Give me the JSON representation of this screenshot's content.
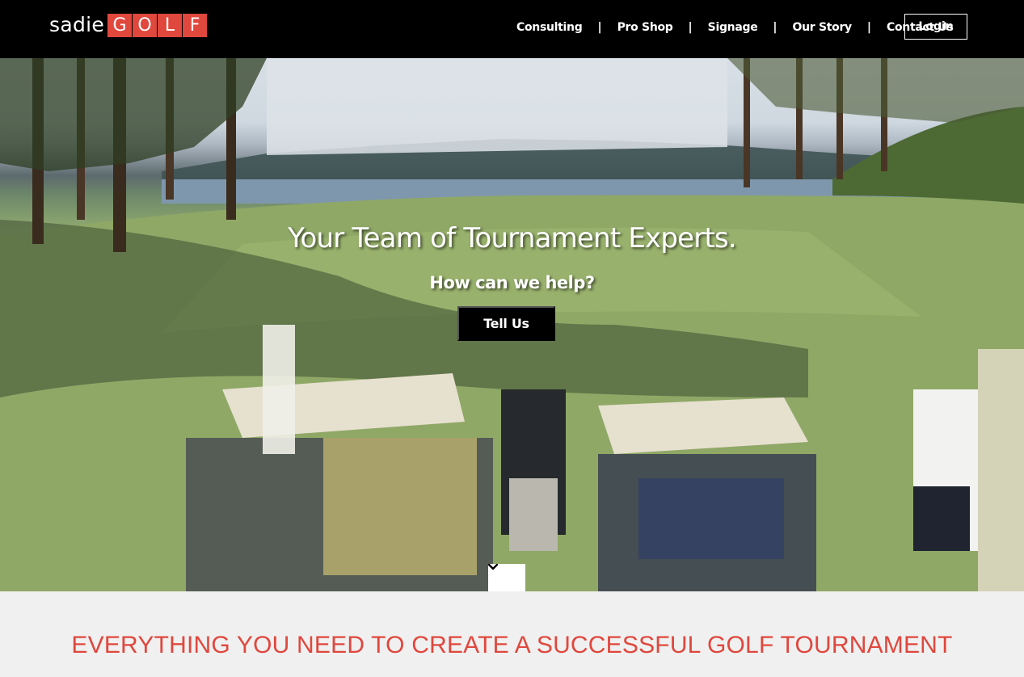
{
  "brand": {
    "name_part1": "sadie",
    "name_part2_letters": [
      "G",
      "O",
      "L",
      "F"
    ],
    "accent_color": "#e0473d"
  },
  "nav": {
    "items": [
      "Consulting",
      "Pro Shop",
      "Signage",
      "Our Story",
      "Contact Us"
    ],
    "separator": "|",
    "login_label": "Login"
  },
  "hero": {
    "title": "Your Team of Tournament Experts.",
    "subtitle": "How can we help?",
    "cta_label": "Tell Us",
    "scroll_icon": "chevron-down-icon"
  },
  "section": {
    "title": "EVERYTHING YOU NEED TO CREATE A SUCCESSFUL GOLF TOURNAMENT"
  }
}
